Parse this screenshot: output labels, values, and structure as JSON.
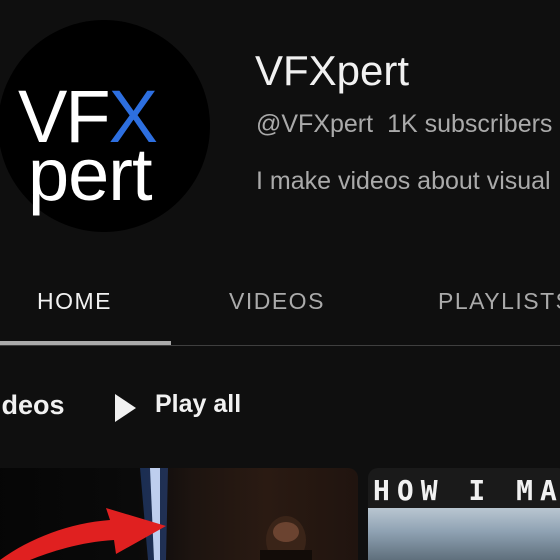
{
  "channel": {
    "avatar_logo_line1_part1": "VF",
    "avatar_logo_line1_x": "X",
    "avatar_logo_line2": "pert",
    "name": "VFXpert",
    "handle": "@VFXpert",
    "subscribers": "1K subscribers",
    "description": "I make videos about visual"
  },
  "tabs": [
    {
      "label": "HOME",
      "active": true
    },
    {
      "label": "VIDEOS",
      "active": false
    },
    {
      "label": "PLAYLISTS",
      "active": false
    }
  ],
  "section": {
    "title": "ideos",
    "play_all_label": "Play all",
    "play_icon": "play-icon"
  },
  "thumbnails": [
    {
      "overlay_text": ""
    },
    {
      "overlay_text": "HOW I MA"
    }
  ],
  "colors": {
    "background": "#0f0f0f",
    "text_primary": "#f1f1f1",
    "text_secondary": "#aaaaaa",
    "logo_accent": "#2d6fe0",
    "arrow_red": "#e02020"
  }
}
